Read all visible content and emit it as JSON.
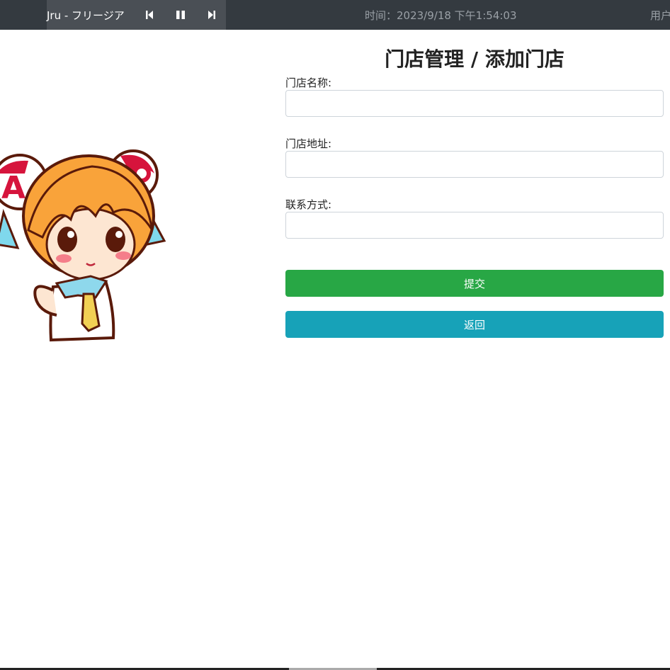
{
  "player": {
    "song_title": "Jru - フリージア",
    "controls": [
      "previous-icon",
      "pause-icon",
      "next-icon"
    ]
  },
  "header": {
    "time_text": "时间：2023/9/18 下午1:54:03",
    "user_text": "用户"
  },
  "page": {
    "title": "门店管理 / 添加门店"
  },
  "form": {
    "fields": [
      {
        "label": "门店名称:",
        "value": "",
        "placeholder": ""
      },
      {
        "label": "门店地址:",
        "value": "",
        "placeholder": ""
      },
      {
        "label": "联系方式:",
        "value": "",
        "placeholder": ""
      }
    ],
    "submit_label": "提交",
    "back_label": "返回"
  },
  "colors": {
    "topbar": "#343a40",
    "player_bg": "#4a4f55",
    "submit": "#28a745",
    "back": "#17a2b8"
  }
}
